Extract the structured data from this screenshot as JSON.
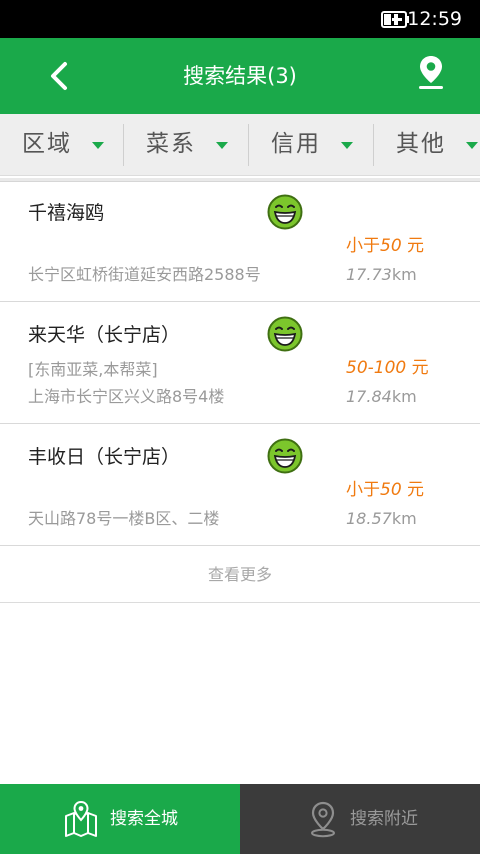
{
  "status_bar": {
    "time": "12:59",
    "battery_icon": "battery-charging-icon"
  },
  "app_bar": {
    "title": "搜索结果(3)",
    "back_icon": "back-arrow-icon",
    "location_icon": "map-pin-icon"
  },
  "filters": [
    {
      "label": "区域"
    },
    {
      "label": "菜系"
    },
    {
      "label": "信用"
    },
    {
      "label": "其他"
    }
  ],
  "results": [
    {
      "name": "千禧海鸥",
      "tags": "",
      "price_prefix": "小于",
      "price_value": "50",
      "price_unit": " 元",
      "address": "长宁区虹桥街道延安西路2588号",
      "distance_value": "17.73",
      "distance_unit": "km",
      "rating_icon": "smile-face-icon"
    },
    {
      "name": "来天华（长宁店）",
      "tags": "[东南亚菜,本帮菜]",
      "price_prefix": "",
      "price_value": "50-100",
      "price_unit": " 元",
      "address": "上海市长宁区兴义路8号4楼",
      "distance_value": "17.84",
      "distance_unit": "km",
      "rating_icon": "smile-face-icon"
    },
    {
      "name": "丰收日（长宁店）",
      "tags": "",
      "price_prefix": "小于",
      "price_value": "50",
      "price_unit": " 元",
      "address": "天山路78号一楼B区、二楼",
      "distance_value": "18.57",
      "distance_unit": "km",
      "rating_icon": "smile-face-icon"
    }
  ],
  "load_more": "查看更多",
  "bottom_nav": {
    "tabs": [
      {
        "label": "搜索全城",
        "icon": "city-map-icon",
        "active": true
      },
      {
        "label": "搜索附近",
        "icon": "nearby-pin-icon",
        "active": false
      }
    ]
  },
  "colors": {
    "primary_green": "#1aa94a",
    "price_orange": "#f07a10",
    "inactive_nav": "#3b3b3b"
  }
}
